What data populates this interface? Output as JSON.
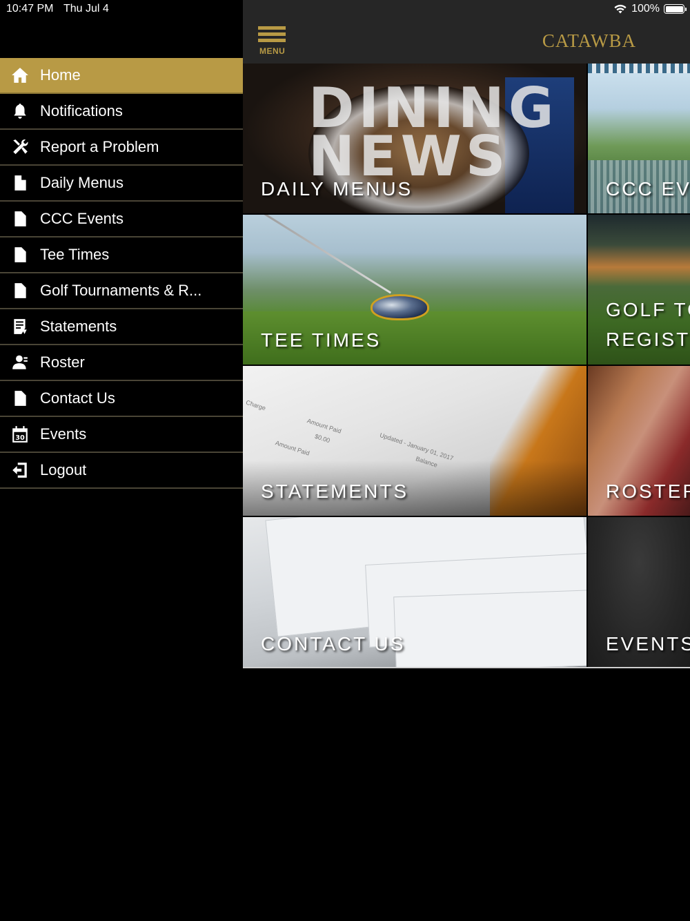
{
  "status_bar": {
    "time": "10:47 PM",
    "date": "Thu Jul 4",
    "battery_text": "100%",
    "battery_level_percent": 100
  },
  "header": {
    "menu_button_label": "MENU",
    "brand": "CATAWBA"
  },
  "colors": {
    "accent": "#b89a45",
    "sidebar_bg": "#000000",
    "topbar_bg": "#262626"
  },
  "sidebar": {
    "items": [
      {
        "label": "Home",
        "icon": "home-icon",
        "active": true
      },
      {
        "label": "Notifications",
        "icon": "bell-icon",
        "active": false
      },
      {
        "label": "Report a Problem",
        "icon": "tools-icon",
        "active": false
      },
      {
        "label": "Daily Menus",
        "icon": "document-icon",
        "active": false
      },
      {
        "label": "CCC Events",
        "icon": "document-icon",
        "active": false
      },
      {
        "label": "Tee Times",
        "icon": "document-icon",
        "active": false
      },
      {
        "label": "Golf Tournaments & R...",
        "icon": "document-icon",
        "active": false
      },
      {
        "label": "Statements",
        "icon": "statement-icon",
        "active": false
      },
      {
        "label": "Roster",
        "icon": "roster-icon",
        "active": false
      },
      {
        "label": "Contact Us",
        "icon": "document-icon",
        "active": false
      },
      {
        "label": "Events",
        "icon": "calendar-icon",
        "active": false
      },
      {
        "label": "Logout",
        "icon": "logout-icon",
        "active": false
      }
    ]
  },
  "calendar_icon_text": "30",
  "tiles": {
    "daily_menus": {
      "label": "DAILY MENUS",
      "image_text": "DINING NEWS"
    },
    "ccc_events": {
      "label": "CCC EVE"
    },
    "tee_times": {
      "label": "TEE TIMES"
    },
    "golf": {
      "line1": "GOLF TO",
      "line2": "REGISTI"
    },
    "statements": {
      "label": "STATEMENTS",
      "image_text": [
        "Charge",
        "Amount Paid",
        "Updated - January 01, 2017",
        "$0.00",
        "Amount Paid",
        "Balance"
      ]
    },
    "roster": {
      "label": "ROSTER"
    },
    "contact_us": {
      "label": "CONTACT US"
    },
    "events": {
      "label": "EVENTS"
    }
  }
}
